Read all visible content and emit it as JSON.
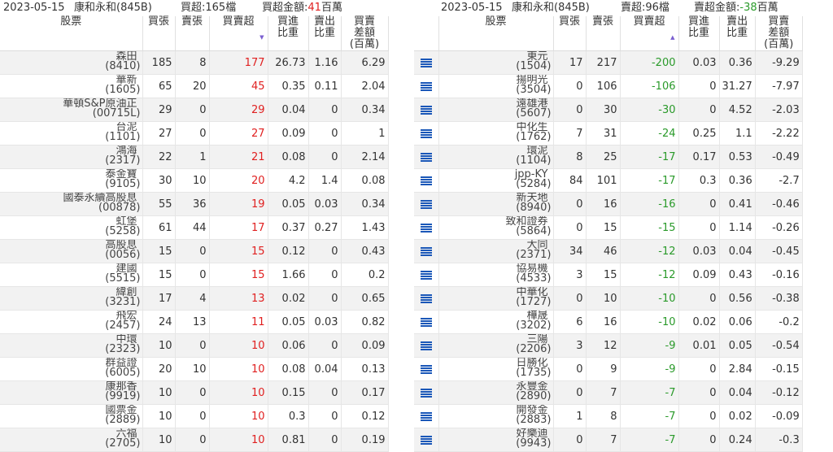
{
  "left": {
    "date": "2023-05-15",
    "broker": "康和永和(845B)",
    "count_label": "買超:165檔",
    "amount_prefix": "買超金額:",
    "amount_value": "41",
    "amount_unit": "百萬",
    "headers": {
      "stock": "股票",
      "buy": "買張",
      "sell": "賣張",
      "net": "買賣超",
      "buy_pct_1": "買進",
      "buy_pct_2": "比重",
      "sell_pct_1": "賣出",
      "sell_pct_2": "比重",
      "diff_1": "買賣",
      "diff_2": "差額",
      "diff_3": "(百萬)"
    },
    "rows": [
      {
        "name": "森田",
        "code": "(8410)",
        "buy": "185",
        "sell": "8",
        "net": "177",
        "bp": "26.73",
        "sp": "1.16",
        "diff": "6.29"
      },
      {
        "name": "華新",
        "code": "(1605)",
        "buy": "65",
        "sell": "20",
        "net": "45",
        "bp": "0.35",
        "sp": "0.11",
        "diff": "2.04"
      },
      {
        "name": "華頓S&P原油正",
        "code": "(00715L)",
        "buy": "29",
        "sell": "0",
        "net": "29",
        "bp": "0.04",
        "sp": "0",
        "diff": "0.34"
      },
      {
        "name": "台泥",
        "code": "(1101)",
        "buy": "27",
        "sell": "0",
        "net": "27",
        "bp": "0.09",
        "sp": "0",
        "diff": "1"
      },
      {
        "name": "鴻海",
        "code": "(2317)",
        "buy": "22",
        "sell": "1",
        "net": "21",
        "bp": "0.08",
        "sp": "0",
        "diff": "2.14"
      },
      {
        "name": "泰金寶",
        "code": "(9105)",
        "buy": "30",
        "sell": "10",
        "net": "20",
        "bp": "4.2",
        "sp": "1.4",
        "diff": "0.08"
      },
      {
        "name": "國泰永續高股息",
        "code": "(00878)",
        "buy": "55",
        "sell": "36",
        "net": "19",
        "bp": "0.05",
        "sp": "0.03",
        "diff": "0.34"
      },
      {
        "name": "虹堡",
        "code": "(5258)",
        "buy": "61",
        "sell": "44",
        "net": "17",
        "bp": "0.37",
        "sp": "0.27",
        "diff": "1.43"
      },
      {
        "name": "高股息",
        "code": "(0056)",
        "buy": "15",
        "sell": "0",
        "net": "15",
        "bp": "0.12",
        "sp": "0",
        "diff": "0.43"
      },
      {
        "name": "建國",
        "code": "(5515)",
        "buy": "15",
        "sell": "0",
        "net": "15",
        "bp": "1.66",
        "sp": "0",
        "diff": "0.2"
      },
      {
        "name": "緯創",
        "code": "(3231)",
        "buy": "17",
        "sell": "4",
        "net": "13",
        "bp": "0.02",
        "sp": "0",
        "diff": "0.65"
      },
      {
        "name": "飛宏",
        "code": "(2457)",
        "buy": "24",
        "sell": "13",
        "net": "11",
        "bp": "0.05",
        "sp": "0.03",
        "diff": "0.82"
      },
      {
        "name": "中環",
        "code": "(2323)",
        "buy": "10",
        "sell": "0",
        "net": "10",
        "bp": "0.06",
        "sp": "0",
        "diff": "0.09"
      },
      {
        "name": "群益證",
        "code": "(6005)",
        "buy": "20",
        "sell": "10",
        "net": "10",
        "bp": "0.08",
        "sp": "0.04",
        "diff": "0.13"
      },
      {
        "name": "康那香",
        "code": "(9919)",
        "buy": "10",
        "sell": "0",
        "net": "10",
        "bp": "0.15",
        "sp": "0",
        "diff": "0.17"
      },
      {
        "name": "國票金",
        "code": "(2889)",
        "buy": "10",
        "sell": "0",
        "net": "10",
        "bp": "0.3",
        "sp": "0",
        "diff": "0.12"
      },
      {
        "name": "六福",
        "code": "(2705)",
        "buy": "10",
        "sell": "0",
        "net": "10",
        "bp": "0.81",
        "sp": "0",
        "diff": "0.19"
      }
    ]
  },
  "right": {
    "date": "2023-05-15",
    "broker": "康和永和(845B)",
    "count_label": "賣超:96檔",
    "amount_prefix": "賣超金額:",
    "amount_value": "-38",
    "amount_unit": "百萬",
    "headers": {
      "stock": "股票",
      "buy": "買張",
      "sell": "賣張",
      "net": "買賣超",
      "buy_pct_1": "買進",
      "buy_pct_2": "比重",
      "sell_pct_1": "賣出",
      "sell_pct_2": "比重",
      "diff_1": "買賣",
      "diff_2": "差額",
      "diff_3": "(百萬)"
    },
    "rows": [
      {
        "name": "東元",
        "code": "(1504)",
        "buy": "17",
        "sell": "217",
        "net": "-200",
        "bp": "0.03",
        "sp": "0.36",
        "diff": "-9.29"
      },
      {
        "name": "揚明光",
        "code": "(3504)",
        "buy": "0",
        "sell": "106",
        "net": "-106",
        "bp": "0",
        "sp": "31.27",
        "diff": "-7.97"
      },
      {
        "name": "遠雄港",
        "code": "(5607)",
        "buy": "0",
        "sell": "30",
        "net": "-30",
        "bp": "0",
        "sp": "4.52",
        "diff": "-2.03"
      },
      {
        "name": "中化生",
        "code": "(1762)",
        "buy": "7",
        "sell": "31",
        "net": "-24",
        "bp": "0.25",
        "sp": "1.1",
        "diff": "-2.22"
      },
      {
        "name": "環泥",
        "code": "(1104)",
        "buy": "8",
        "sell": "25",
        "net": "-17",
        "bp": "0.17",
        "sp": "0.53",
        "diff": "-0.49"
      },
      {
        "name": "jpp-KY",
        "code": "(5284)",
        "buy": "84",
        "sell": "101",
        "net": "-17",
        "bp": "0.3",
        "sp": "0.36",
        "diff": "-2.7"
      },
      {
        "name": "新天地",
        "code": "(8940)",
        "buy": "0",
        "sell": "16",
        "net": "-16",
        "bp": "0",
        "sp": "0.41",
        "diff": "-0.46"
      },
      {
        "name": "致和證券",
        "code": "(5864)",
        "buy": "0",
        "sell": "15",
        "net": "-15",
        "bp": "0",
        "sp": "1.14",
        "diff": "-0.26"
      },
      {
        "name": "大同",
        "code": "(2371)",
        "buy": "34",
        "sell": "46",
        "net": "-12",
        "bp": "0.03",
        "sp": "0.04",
        "diff": "-0.45"
      },
      {
        "name": "協易機",
        "code": "(4533)",
        "buy": "3",
        "sell": "15",
        "net": "-12",
        "bp": "0.09",
        "sp": "0.43",
        "diff": "-0.16"
      },
      {
        "name": "中華化",
        "code": "(1727)",
        "buy": "0",
        "sell": "10",
        "net": "-10",
        "bp": "0",
        "sp": "0.56",
        "diff": "-0.38"
      },
      {
        "name": "樺晟",
        "code": "(3202)",
        "buy": "6",
        "sell": "16",
        "net": "-10",
        "bp": "0.02",
        "sp": "0.06",
        "diff": "-0.2"
      },
      {
        "name": "三陽",
        "code": "(2206)",
        "buy": "3",
        "sell": "12",
        "net": "-9",
        "bp": "0.01",
        "sp": "0.05",
        "diff": "-0.54"
      },
      {
        "name": "日勝化",
        "code": "(1735)",
        "buy": "0",
        "sell": "9",
        "net": "-9",
        "bp": "0",
        "sp": "2.84",
        "diff": "-0.15"
      },
      {
        "name": "永豐金",
        "code": "(2890)",
        "buy": "0",
        "sell": "7",
        "net": "-7",
        "bp": "0",
        "sp": "0.04",
        "diff": "-0.12"
      },
      {
        "name": "開發金",
        "code": "(2883)",
        "buy": "1",
        "sell": "8",
        "net": "-7",
        "bp": "0",
        "sp": "0.02",
        "diff": "-0.09"
      },
      {
        "name": "好樂迪",
        "code": "(9943)",
        "buy": "0",
        "sell": "7",
        "net": "-7",
        "bp": "0",
        "sp": "0.24",
        "diff": "-0.3"
      }
    ]
  },
  "colors": {
    "buy_net": "#e02020",
    "sell_net": "#2a9a2a",
    "menu_icon": "#1a57b8",
    "row_alt": "#f2f2f2"
  },
  "icons": {
    "row_menu": "list-menu-icon",
    "sort": "sort-triangle-icon"
  }
}
